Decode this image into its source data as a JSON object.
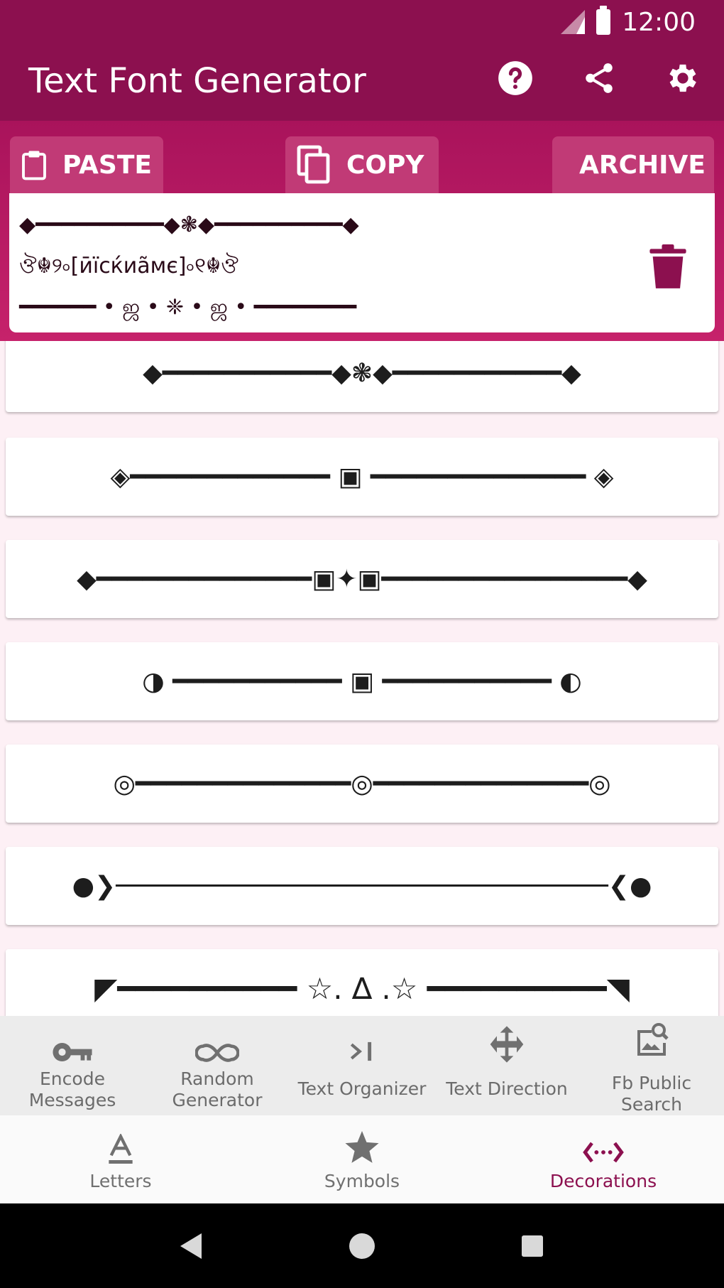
{
  "status": {
    "time": "12:00"
  },
  "app": {
    "title": "Text Font Generator"
  },
  "actions": {
    "paste": "PASTE",
    "copy": "COPY",
    "archive": "ARCHIVE"
  },
  "preview": {
    "line1": "◆━━━━━━━━━━◆❃◆━━━━━━━━━━◆",
    "line2": "ঔ☬୨৹[ӣїсќиа̃мє]৹୧☬ঔ",
    "line3": "━━━━━━ • ஜ • ❈ • ஜ • ━━━━━━━━"
  },
  "decorations": [
    "◆━━━━━━━━━━━◆❃◆━━━━━━━━━━━◆",
    "◈━━━━━━━━━━━━━ ▣ ━━━━━━━━━━━━━━ ◈",
    "◆━━━━━━━━━━━━━━▣✦▣━━━━━━━━━━━━━━━━◆",
    "◑ ━━━━━━━━━━━ ▣ ━━━━━━━━━━━ ◐",
    "◎━━━━━━━━━━━━━━◎━━━━━━━━━━━━━━◎",
    "●❯────────────────────────────────❮●",
    "◤━━━━━━━━━━ ☆. ∆ .☆ ━━━━━━━━━━◥"
  ],
  "tools": [
    {
      "label": "Encode\nMessages",
      "icon": "key-icon"
    },
    {
      "label": "Random\nGenerator",
      "icon": "infinity-icon"
    },
    {
      "label": "Text Organizer",
      "icon": "text-organizer-icon"
    },
    {
      "label": "Text Direction",
      "icon": "move-arrows-icon"
    },
    {
      "label": "Fb Public Search",
      "icon": "image-search-icon"
    }
  ],
  "nav": [
    {
      "label": "Letters",
      "icon": "letter-a-icon",
      "active": false
    },
    {
      "label": "Symbols",
      "icon": "star-icon",
      "active": false
    },
    {
      "label": "Decorations",
      "icon": "code-arrows-icon",
      "active": true
    }
  ],
  "colors": {
    "primary": "#8c104f",
    "accent": "#c6226b",
    "list_bg": "#fdf0f5"
  }
}
